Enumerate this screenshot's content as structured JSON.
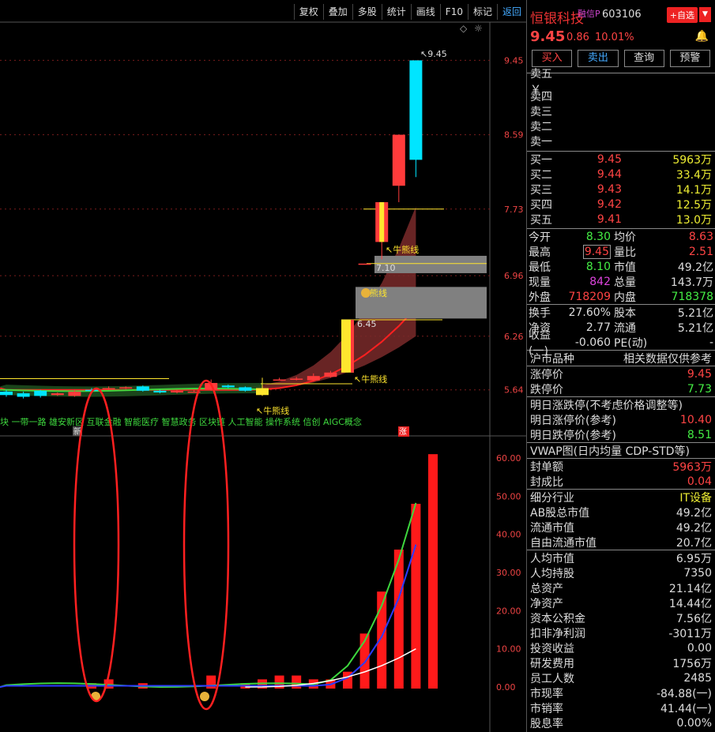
{
  "toolbar": {
    "items": [
      "复权",
      "叠加",
      "多股",
      "统计",
      "画线",
      "F10",
      "标记",
      "返回"
    ]
  },
  "chart": {
    "price_axis": [
      "9.45",
      "8.59",
      "7.73",
      "6.96",
      "6.26",
      "5.64"
    ],
    "ind_axis": [
      "60.00",
      "50.00",
      "40.00",
      "30.00",
      "20.00",
      "10.00",
      "0.00"
    ],
    "annotations": {
      "high_label": "9.45",
      "label_710": "7.10",
      "label_645": "6.45",
      "bull1": "牛熊线",
      "bull2": "牛熊线",
      "bull3": "牛熊线",
      "bull4": "牛熊线",
      "limit_mark": "涨",
      "prev_mark": "新"
    },
    "concepts": "块 一带一路 雄安新区 互联金融 智能医疗 智慧政务 区块链 人工智能 操作系统 信创 AIGC概念",
    "colors": {
      "up": "#ff3b3b",
      "down": "#00e5ff",
      "ma": "#ff2020",
      "band": "#7a2a2a",
      "yellow": "#ffe62e",
      "green": "#3ed83e",
      "blue": "#2c3cff",
      "gray": "#808080"
    }
  },
  "chart_data": {
    "type": "candlestick",
    "candles": [
      {
        "o": 5.62,
        "c": 5.58,
        "h": 5.64,
        "l": 5.56
      },
      {
        "o": 5.6,
        "c": 5.56,
        "h": 5.62,
        "l": 5.54
      },
      {
        "o": 5.63,
        "c": 5.57,
        "h": 5.64,
        "l": 5.55
      },
      {
        "o": 5.58,
        "c": 5.6,
        "h": 5.61,
        "l": 5.57
      },
      {
        "o": 5.57,
        "c": 5.62,
        "h": 5.64,
        "l": 5.56
      },
      {
        "o": 5.64,
        "c": 5.63,
        "h": 5.66,
        "l": 5.62
      },
      {
        "o": 5.66,
        "c": 5.66,
        "h": 5.68,
        "l": 5.64
      },
      {
        "o": 5.67,
        "c": 5.67,
        "h": 5.68,
        "l": 5.65
      },
      {
        "o": 5.68,
        "c": 5.63,
        "h": 5.69,
        "l": 5.62
      },
      {
        "o": 5.63,
        "c": 5.61,
        "h": 5.64,
        "l": 5.6
      },
      {
        "o": 5.61,
        "c": 5.63,
        "h": 5.64,
        "l": 5.6
      },
      {
        "o": 5.62,
        "c": 5.62,
        "h": 5.64,
        "l": 5.61
      },
      {
        "o": 5.64,
        "c": 5.72,
        "h": 5.76,
        "l": 5.63
      },
      {
        "o": 5.69,
        "c": 5.67,
        "h": 5.7,
        "l": 5.66
      },
      {
        "o": 5.67,
        "c": 5.63,
        "h": 5.68,
        "l": 5.62
      },
      {
        "o": 5.58,
        "c": 5.66,
        "h": 5.78,
        "l": 5.57
      },
      {
        "o": 5.76,
        "c": 5.76,
        "h": 5.78,
        "l": 5.75
      },
      {
        "o": 5.76,
        "c": 5.77,
        "h": 5.79,
        "l": 5.75
      },
      {
        "o": 5.75,
        "c": 5.8,
        "h": 5.83,
        "l": 5.74
      },
      {
        "o": 5.79,
        "c": 5.84,
        "h": 5.86,
        "l": 5.78
      },
      {
        "o": 5.84,
        "c": 6.45,
        "h": 6.45,
        "l": 5.84
      },
      {
        "o": 7.1,
        "c": 7.1,
        "h": 7.1,
        "l": 7.1
      },
      {
        "o": 7.35,
        "c": 7.81,
        "h": 7.81,
        "l": 7.15
      },
      {
        "o": 8.0,
        "c": 8.59,
        "h": 8.59,
        "l": 7.81
      },
      {
        "o": 9.45,
        "c": 8.3,
        "h": 9.45,
        "l": 8.1
      }
    ],
    "indicator_bars": [
      0,
      0,
      0,
      0,
      0,
      1,
      2,
      0,
      1,
      0,
      0,
      0,
      3,
      0,
      1,
      2,
      3,
      3,
      2,
      2,
      4,
      14,
      25,
      36,
      48,
      61
    ],
    "indicator_y_range": [
      0,
      60
    ],
    "y_range": [
      5.4,
      9.6
    ]
  },
  "panel": {
    "name": "恒银科技",
    "tag": "融信P",
    "code": "603106",
    "fav": "+自选",
    "fav_arrow": "▼",
    "price": "9.45",
    "change": "0.86",
    "pct": "10.01%",
    "bell": "🔔",
    "actions": [
      "买入",
      "卖出",
      "查询",
      "预警"
    ],
    "sells": [
      "卖五 ￥",
      "卖四",
      "卖三",
      "卖二",
      "卖一"
    ],
    "buys": [
      {
        "l": "买一",
        "p": "9.45",
        "v": "5963万"
      },
      {
        "l": "买二",
        "p": "9.44",
        "v": "33.4万"
      },
      {
        "l": "买三",
        "p": "9.43",
        "v": "14.1万"
      },
      {
        "l": "买四",
        "p": "9.42",
        "v": "12.5万"
      },
      {
        "l": "买五",
        "p": "9.41",
        "v": "13.0万"
      }
    ],
    "quote": [
      {
        "l": "今开",
        "v": "8.30",
        "vc": "green",
        "l2": "均价",
        "v2": "8.63",
        "v2c": "red"
      },
      {
        "l": "最高",
        "v": "9.45",
        "vc": "red",
        "l2": "量比",
        "v2": "2.51",
        "v2c": "red",
        "box": true
      },
      {
        "l": "最低",
        "v": "8.10",
        "vc": "green",
        "l2": "市值",
        "v2": "49.2亿",
        "v2c": "white"
      },
      {
        "l": "现量",
        "v": "842",
        "vc": "purple",
        "l2": "总量",
        "v2": "143.7万",
        "v2c": "white"
      },
      {
        "l": "外盘",
        "v": "718209",
        "vc": "red",
        "l2": "内盘",
        "v2": "718378",
        "v2c": "green"
      }
    ],
    "quote2": [
      {
        "l": "换手",
        "v": "27.60%",
        "vc": "white",
        "l2": "股本",
        "v2": "5.21亿",
        "v2c": "white"
      },
      {
        "l": "净资",
        "v": "2.77",
        "vc": "white",
        "l2": "流通",
        "v2": "5.21亿",
        "v2c": "white"
      },
      {
        "l": "收益(一)",
        "v": "-0.060",
        "vc": "white",
        "l2": "PE(动)",
        "v2": "-",
        "v2c": "white"
      }
    ],
    "market": {
      "l": "沪市品种",
      "r": "相关数据仅供参考"
    },
    "limits": [
      {
        "l": "涨停价",
        "v": "9.45",
        "c": "red"
      },
      {
        "l": "跌停价",
        "v": "7.73",
        "c": "green"
      }
    ],
    "next_title": "明日涨跌停(不考虑价格调整等)",
    "next": [
      {
        "l": "明日涨停价(参考)",
        "v": "10.40",
        "c": "red"
      },
      {
        "l": "明日跌停价(参考)",
        "v": "8.51",
        "c": "green"
      }
    ],
    "vwap": "VWAP图(日内均量 CDP-STD等)",
    "seal": [
      {
        "l": "封单额",
        "v": "5963万",
        "c": "red"
      },
      {
        "l": "封成比",
        "v": "0.04",
        "c": "red"
      }
    ],
    "fund": [
      {
        "l": "细分行业",
        "v": "IT设备",
        "c": "yellow"
      },
      {
        "l": "AB股总市值",
        "v": "49.2亿",
        "c": "white"
      },
      {
        "l": "流通市值",
        "v": "49.2亿",
        "c": "white"
      },
      {
        "l": "自由流通市值",
        "v": "20.7亿",
        "c": "white"
      },
      {
        "l": "人均市值",
        "v": "6.95万",
        "c": "white",
        "div": true
      },
      {
        "l": "人均持股",
        "v": "7350",
        "c": "white"
      },
      {
        "l": "总资产",
        "v": "21.14亿",
        "c": "white"
      },
      {
        "l": "净资产",
        "v": "14.44亿",
        "c": "white"
      },
      {
        "l": "资本公积金",
        "v": "7.56亿",
        "c": "white"
      },
      {
        "l": "扣非净利润",
        "v": "-3011万",
        "c": "white"
      },
      {
        "l": "投资收益",
        "v": "0.00",
        "c": "white"
      },
      {
        "l": "研发费用",
        "v": "1756万",
        "c": "white"
      },
      {
        "l": "员工人数",
        "v": "2485",
        "c": "white"
      },
      {
        "l": "市现率",
        "v": "-84.88(一)",
        "c": "white"
      },
      {
        "l": "市销率",
        "v": "41.44(一)",
        "c": "white"
      },
      {
        "l": "股息率",
        "v": "0.00%",
        "c": "white"
      }
    ]
  }
}
